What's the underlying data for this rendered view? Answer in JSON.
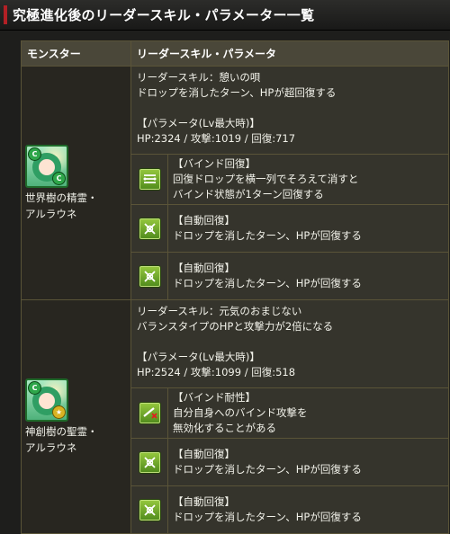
{
  "page_title": "究極進化後のリーダースキル・パラメーター一覧",
  "table": {
    "header_monster": "モンスター",
    "header_skill": "リーダースキル・パラメータ"
  },
  "monsters": [
    {
      "name_line1": "世界樹の精霊・",
      "name_line2": "アルラウネ",
      "attr_badge": "C",
      "sub_badge": "C",
      "leader_skill_title": "リーダースキル：憩いの唄",
      "leader_skill_desc": "ドロップを消したターン、HPが超回復する",
      "param_title": "【パラメータ(Lv最大時)】",
      "param_values": "HP:2324 / 攻撃:1019 / 回復:717",
      "awakenings": [
        {
          "icon": "bind-recovery-icon",
          "name": "【バインド回復】",
          "desc_line1": "回復ドロップを横一列でそろえて消すと",
          "desc_line2": "バインド状態が1ターン回復する"
        },
        {
          "icon": "auto-recover-icon",
          "name": "【自動回復】",
          "desc_line1": "ドロップを消したターン、HPが回復する"
        },
        {
          "icon": "auto-recover-icon",
          "name": "【自動回復】",
          "desc_line1": "ドロップを消したターン、HPが回復する"
        }
      ]
    },
    {
      "name_line1": "神創樹の聖霊・",
      "name_line2": "アルラウネ",
      "attr_badge": "C",
      "sub_badge": "★",
      "leader_skill_title": "リーダースキル：元気のおまじない",
      "leader_skill_desc": "バランスタイプのHPと攻撃力が2倍になる",
      "param_title": "【パラメータ(Lv最大時)】",
      "param_values": "HP:2524 / 攻撃:1099 / 回復:518",
      "awakenings": [
        {
          "icon": "bind-resist-icon",
          "name": "【バインド耐性】",
          "desc_line1": "自分自身へのバインド攻撃を",
          "desc_line2": "無効化することがある"
        },
        {
          "icon": "auto-recover-icon",
          "name": "【自動回復】",
          "desc_line1": "ドロップを消したターン、HPが回復する"
        },
        {
          "icon": "auto-recover-icon",
          "name": "【自動回復】",
          "desc_line1": "ドロップを消したターン、HPが回復する"
        }
      ]
    }
  ],
  "colors": {
    "title_accent": "#b32025",
    "header_bg": "#4a4739",
    "cell_bg": "#35342c",
    "border": "#5a5438",
    "awakening_icon": "#7fb32e"
  }
}
